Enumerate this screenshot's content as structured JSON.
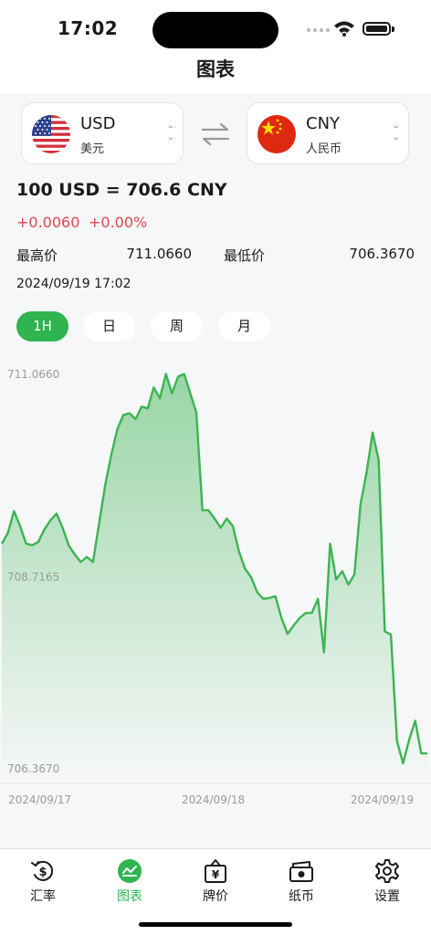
{
  "status_bar": {
    "time": "17:02"
  },
  "nav": {
    "title": "图表"
  },
  "from_currency": {
    "code": "USD",
    "name": "美元",
    "flag_icon": "us-flag-icon"
  },
  "to_currency": {
    "code": "CNY",
    "name": "人民币",
    "flag_icon": "cn-flag-icon"
  },
  "rate": {
    "summary": "100 USD = 706.6 CNY",
    "change_abs": "+0.0060",
    "change_pct": "+0.00%",
    "high_label": "最高价",
    "high_value": "711.0660",
    "low_label": "最低价",
    "low_value": "706.3670",
    "datetime": "2024/09/19 17:02"
  },
  "range_tabs": [
    {
      "label": "1H",
      "active": true
    },
    {
      "label": "日",
      "active": false
    },
    {
      "label": "周",
      "active": false
    },
    {
      "label": "月",
      "active": false
    }
  ],
  "chart_data": {
    "type": "area",
    "x_ticks": [
      "2024/09/17",
      "2024/09/18",
      "2024/09/19"
    ],
    "y_ticks": [
      "711.0660",
      "708.7165",
      "706.3670"
    ],
    "ylim": [
      706.367,
      711.066
    ],
    "color": "#3cb453",
    "values": [
      709.04,
      709.17,
      709.43,
      709.25,
      709.04,
      709.02,
      709.06,
      709.21,
      709.32,
      709.4,
      709.23,
      709.02,
      708.91,
      708.82,
      708.88,
      708.82,
      709.28,
      709.74,
      710.1,
      710.41,
      710.58,
      710.6,
      710.53,
      710.68,
      710.66,
      710.91,
      710.78,
      711.07,
      710.84,
      711.04,
      711.07,
      710.84,
      710.61,
      709.44,
      709.44,
      709.34,
      709.23,
      709.34,
      709.25,
      708.95,
      708.74,
      708.64,
      708.46,
      708.38,
      708.39,
      708.41,
      708.15,
      707.96,
      708.06,
      708.15,
      708.21,
      708.21,
      708.38,
      707.74,
      709.04,
      708.61,
      708.71,
      708.55,
      708.67,
      709.51,
      709.89,
      710.37,
      710.04,
      707.99,
      707.95,
      706.68,
      706.41,
      706.69,
      706.92,
      706.53,
      706.53
    ]
  },
  "tab_bar": [
    {
      "label": "汇率",
      "icon": "exchange-rate-icon",
      "active": false
    },
    {
      "label": "图表",
      "icon": "chart-icon",
      "active": true
    },
    {
      "label": "牌价",
      "icon": "price-board-icon",
      "active": false
    },
    {
      "label": "纸币",
      "icon": "banknote-icon",
      "active": false
    },
    {
      "label": "设置",
      "icon": "gear-icon",
      "active": false
    }
  ]
}
